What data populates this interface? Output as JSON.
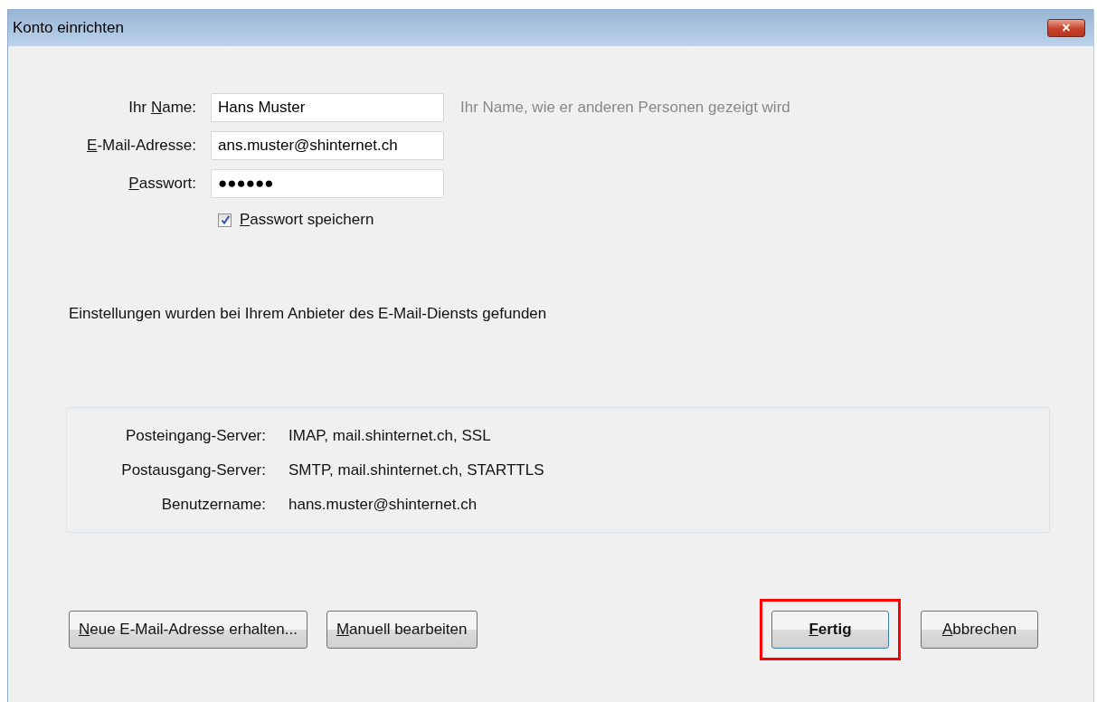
{
  "window": {
    "title": "Konto einrichten",
    "close_label": "×"
  },
  "fields": [
    {
      "label": {
        "pre": "Ihr ",
        "key": "N",
        "post": "ame:"
      },
      "value": "Hans Muster",
      "hint": "Ihr Name, wie er anderen Personen gezeigt wird"
    },
    {
      "label": {
        "key": "E",
        "post": "-Mail-Adresse:"
      },
      "value": "ans.muster@shinternet.ch"
    },
    {
      "label": {
        "key": "P",
        "post": "asswort:"
      },
      "value": "●●●●●●"
    }
  ],
  "remember": {
    "label": {
      "key": "P",
      "post": "asswort speichern"
    },
    "checked": true
  },
  "message": "Einstellungen wurden bei Ihrem Anbieter des E-Mail-Diensts gefunden",
  "servers": [
    {
      "label": "Posteingang-Server:",
      "value": "IMAP, mail.shinternet.ch, SSL"
    },
    {
      "label": "Postausgang-Server:",
      "value": "SMTP, mail.shinternet.ch, STARTTLS"
    },
    {
      "label": "Benutzername:",
      "value": "hans.muster@shinternet.ch"
    }
  ],
  "buttons_left": [
    {
      "label": {
        "key": "N",
        "post": "eue E-Mail-Adresse erhalten..."
      }
    },
    {
      "label": {
        "key": "M",
        "post": "anuell bearbeiten"
      }
    }
  ],
  "buttons_right": [
    {
      "label": {
        "key": "F",
        "post": "ertig"
      },
      "default": true,
      "highlighted": true
    },
    {
      "label": {
        "key": "A",
        "post": "bbrechen"
      },
      "default": false,
      "highlighted": false
    }
  ]
}
